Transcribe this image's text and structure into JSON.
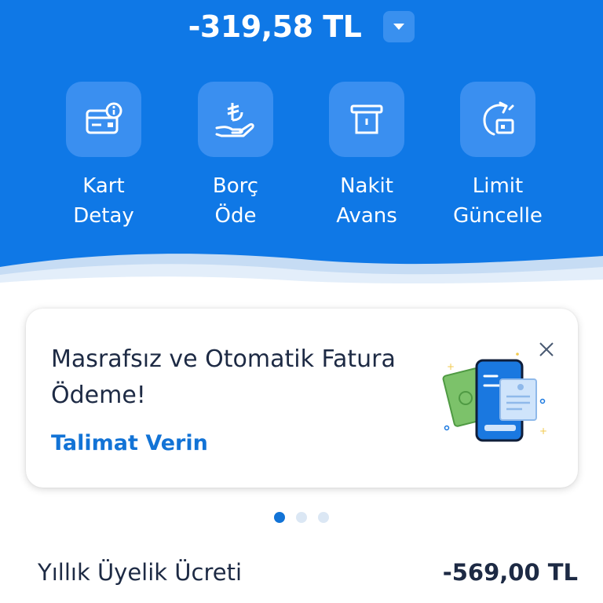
{
  "header": {
    "balance": "-319,58 TL",
    "dropdown_icon": "chevron-down-icon",
    "bg_color": "#0f78e6"
  },
  "actions": [
    {
      "line1": "Kart",
      "line2": "Detay",
      "icon": "card-info-icon"
    },
    {
      "line1": "Borç",
      "line2": "Öde",
      "icon": "lira-hand-icon"
    },
    {
      "line1": "Nakit",
      "line2": "Avans",
      "icon": "atm-withdraw-icon"
    },
    {
      "line1": "Limit",
      "line2": "Güncelle",
      "icon": "limit-refresh-icon"
    }
  ],
  "promo": {
    "title": "Masrafsız ve Otomatik Fatura Ödeme!",
    "link": "Talimat Verin",
    "close_icon": "close-icon",
    "illustration": "phone-bill-payment-illustration",
    "link_color": "#1273d6"
  },
  "carousel": {
    "current_page": 1,
    "total_pages": 3
  },
  "fee": {
    "label": "Yıllık Üyelik Ücreti",
    "value": "-569,00 TL"
  }
}
